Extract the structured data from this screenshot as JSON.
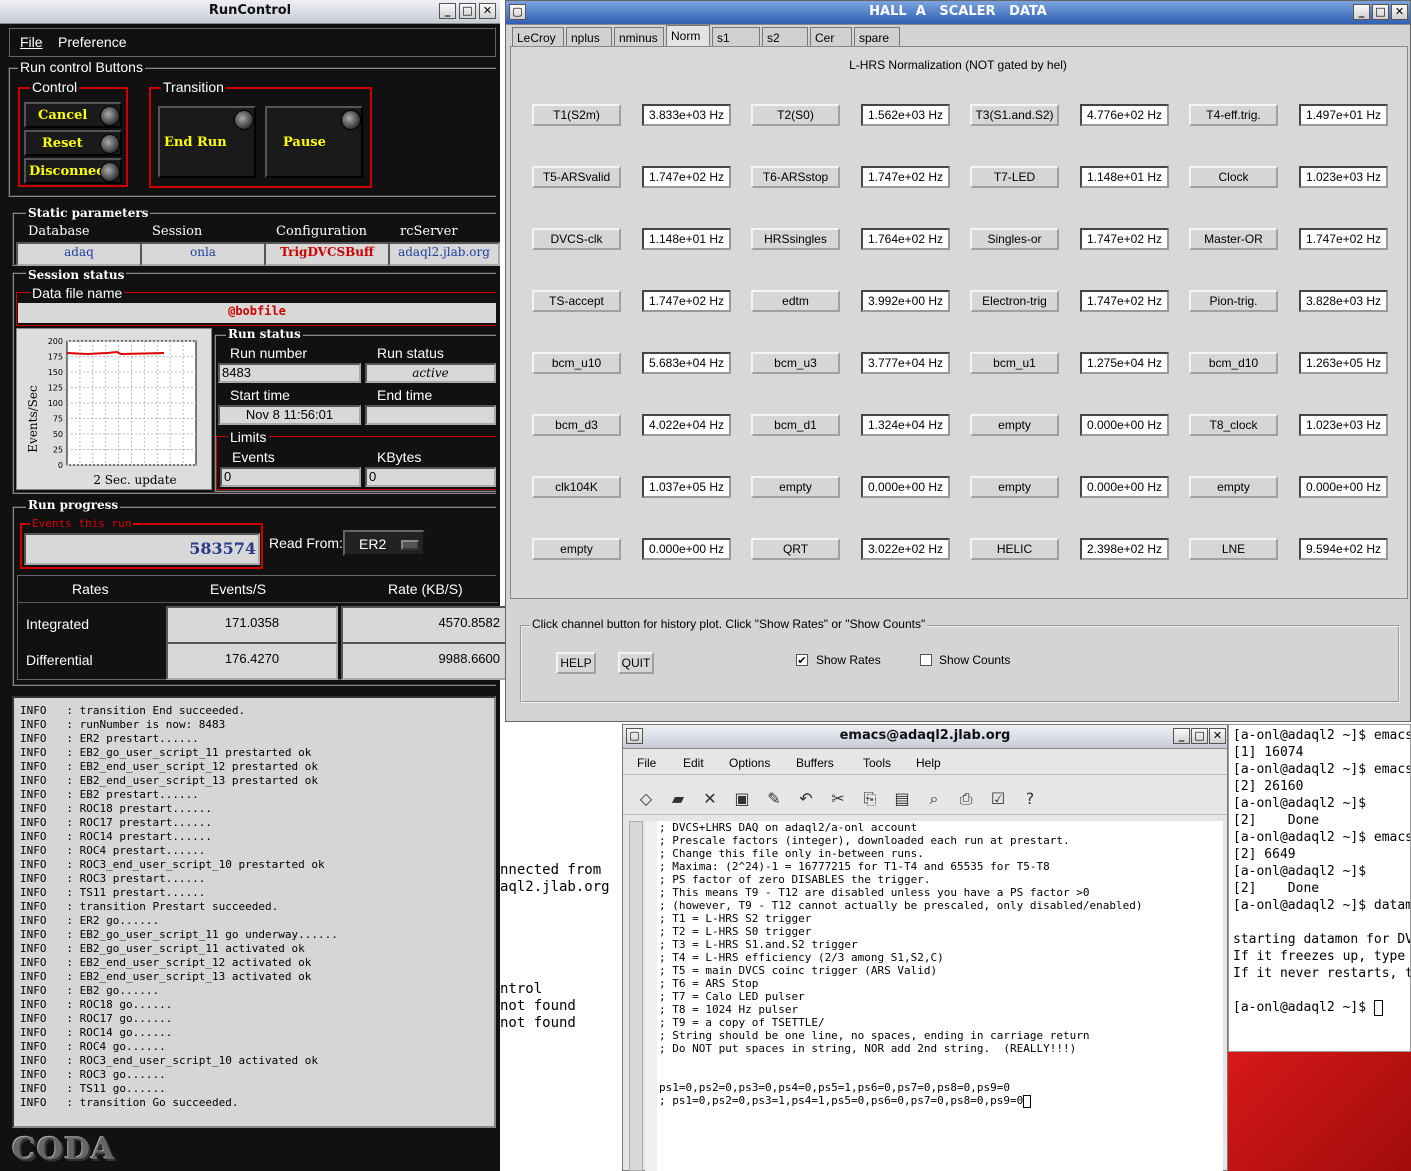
{
  "runcontrol": {
    "title": "RunControl",
    "menu": [
      "File",
      "Preference"
    ],
    "run_control_buttons_label": "Run control Buttons",
    "control_label": "Control",
    "control_buttons": [
      "Cancel",
      "Reset",
      "Disconnect"
    ],
    "transition_label": "Transition",
    "transition_buttons": [
      "End Run",
      "Pause"
    ],
    "static_params_label": "Static parameters",
    "static_params": [
      {
        "label": "Database",
        "value": "adaq"
      },
      {
        "label": "Session",
        "value": "onla"
      },
      {
        "label": "Configuration",
        "value": "TrigDVCSBuff"
      },
      {
        "label": "rcServer",
        "value": "adaql2.jlab.org"
      }
    ],
    "session_status_label": "Session status",
    "data_file_label": "Data file name",
    "data_file_value": "@bobfile",
    "chart_ylabel": "Events/Sec",
    "chart_xlabel": "2 Sec. update",
    "chart_yticks": [
      "200",
      "175",
      "150",
      "125",
      "100",
      "75",
      "50",
      "25",
      "0"
    ],
    "run_status_label": "Run status",
    "run_number_label": "Run number",
    "run_number_value": "8483",
    "run_status_field_label": "Run status",
    "run_status_value": "active",
    "start_time_label": "Start time",
    "start_time_value": "Nov 8 11:56:01",
    "end_time_label": "End time",
    "end_time_value": "",
    "limits_label": "Limits",
    "events_label": "Events",
    "events_value": "0",
    "kbytes_label": "KBytes",
    "kbytes_value": "0",
    "run_progress_label": "Run progress",
    "events_this_run_label": "Events this run",
    "events_this_run_value": "583574",
    "read_from_label": "Read From:",
    "read_from_value": "ER2",
    "rates_header": [
      "Rates",
      "Events/S",
      "Rate (KB/S)"
    ],
    "rates_rows": [
      {
        "label": "Integrated",
        "events": "171.0358",
        "kb": "4570.8582"
      },
      {
        "label": "Differential",
        "events": "176.4270",
        "kb": "9988.6600"
      }
    ],
    "log_lines": [
      "INFO   : transition End succeeded.",
      "INFO   : runNumber is now: 8483",
      "INFO   : ER2 prestart......",
      "INFO   : EB2_go_user_script_11 prestarted ok",
      "INFO   : EB2_end_user_script_12 prestarted ok",
      "INFO   : EB2_end_user_script_13 prestarted ok",
      "INFO   : EB2 prestart......",
      "INFO   : ROC18 prestart......",
      "INFO   : ROC17 prestart......",
      "INFO   : ROC14 prestart......",
      "INFO   : ROC4 prestart......",
      "INFO   : ROC3_end_user_script_10 prestarted ok",
      "INFO   : ROC3 prestart......",
      "INFO   : TS11 prestart......",
      "INFO   : transition Prestart succeeded.",
      "INFO   : ER2 go......",
      "INFO   : EB2_go_user_script_11 go underway......",
      "INFO   : EB2_go_user_script_11 activated ok",
      "INFO   : EB2_end_user_script_12 activated ok",
      "INFO   : EB2_end_user_script_13 activated ok",
      "INFO   : EB2 go......",
      "INFO   : ROC18 go......",
      "INFO   : ROC17 go......",
      "INFO   : ROC14 go......",
      "INFO   : ROC4 go......",
      "INFO   : ROC3_end_user_script_10 activated ok",
      "INFO   : ROC3 go......",
      "INFO   : TS11 go......",
      "INFO   : transition Go succeeded."
    ],
    "coda_logo": "CODA"
  },
  "scaler": {
    "title": "HALL  A   SCALER   DATA",
    "tabs": [
      "LeCroy",
      "nplus",
      "nminus",
      "Norm",
      "s1",
      "s2",
      "Cer",
      "spare"
    ],
    "selected_tab": "Norm",
    "heading": "L-HRS Normalization (NOT gated by hel)",
    "rows": [
      [
        {
          "name": "T1(S2m)",
          "rate": "3.833e+03 Hz"
        },
        {
          "name": "T2(S0)",
          "rate": "1.562e+03 Hz"
        },
        {
          "name": "T3(S1.and.S2)",
          "rate": "4.776e+02 Hz"
        },
        {
          "name": "T4-eff.trig.",
          "rate": "1.497e+01 Hz"
        }
      ],
      [
        {
          "name": "T5-ARSvalid",
          "rate": "1.747e+02 Hz"
        },
        {
          "name": "T6-ARSstop",
          "rate": "1.747e+02 Hz"
        },
        {
          "name": "T7-LED",
          "rate": "1.148e+01 Hz"
        },
        {
          "name": "Clock",
          "rate": "1.023e+03 Hz"
        }
      ],
      [
        {
          "name": "DVCS-clk",
          "rate": "1.148e+01 Hz"
        },
        {
          "name": "HRSsingles",
          "rate": "1.764e+02 Hz"
        },
        {
          "name": "Singles-or",
          "rate": "1.747e+02 Hz"
        },
        {
          "name": "Master-OR",
          "rate": "1.747e+02 Hz"
        }
      ],
      [
        {
          "name": "TS-accept",
          "rate": "1.747e+02 Hz"
        },
        {
          "name": "edtm",
          "rate": "3.992e+00 Hz"
        },
        {
          "name": "Electron-trig",
          "rate": "1.747e+02 Hz"
        },
        {
          "name": "Pion-trig.",
          "rate": "3.828e+03 Hz"
        }
      ],
      [
        {
          "name": "bcm_u10",
          "rate": "5.683e+04 Hz"
        },
        {
          "name": "bcm_u3",
          "rate": "3.777e+04 Hz"
        },
        {
          "name": "bcm_u1",
          "rate": "1.275e+04 Hz"
        },
        {
          "name": "bcm_d10",
          "rate": "1.263e+05 Hz"
        }
      ],
      [
        {
          "name": "bcm_d3",
          "rate": "4.022e+04 Hz"
        },
        {
          "name": "bcm_d1",
          "rate": "1.324e+04 Hz"
        },
        {
          "name": "empty",
          "rate": "0.000e+00 Hz"
        },
        {
          "name": "T8_clock",
          "rate": "1.023e+03 Hz"
        }
      ],
      [
        {
          "name": "clk104K",
          "rate": "1.037e+05 Hz"
        },
        {
          "name": "empty",
          "rate": "0.000e+00 Hz"
        },
        {
          "name": "empty",
          "rate": "0.000e+00 Hz"
        },
        {
          "name": "empty",
          "rate": "0.000e+00 Hz"
        }
      ],
      [
        {
          "name": "empty",
          "rate": "0.000e+00 Hz"
        },
        {
          "name": "QRT",
          "rate": "3.022e+02 Hz"
        },
        {
          "name": "HELIC",
          "rate": "2.398e+02 Hz"
        },
        {
          "name": "LNE",
          "rate": "9.594e+02 Hz"
        }
      ]
    ],
    "hint": "Click channel button for history plot.  Click \"Show Rates\" or \"Show Counts\"",
    "help_label": "HELP",
    "quit_label": "QUIT",
    "show_rates_label": "Show Rates",
    "show_counts_label": "Show Counts"
  },
  "emacs": {
    "title": "emacs@adaql2.jlab.org",
    "menu": [
      "File",
      "Edit",
      "Options",
      "Buffers",
      "Tools",
      "Help"
    ],
    "lines": [
      "; DVCS+LHRS DAQ on adaql2/a-onl account",
      "; Prescale factors (integer), downloaded each run at prestart.",
      "; Change this file only in-between runs.",
      "; Maxima: (2^24)-1 = 16777215 for T1-T4 and 65535 for T5-T8",
      "; PS factor of zero DISABLES the trigger.",
      "; This means T9 - T12 are disabled unless you have a PS factor >0",
      "; (however, T9 - T12 cannot actually be prescaled, only disabled/enabled)",
      "; T1 = L-HRS S2 trigger",
      "; T2 = L-HRS S0 trigger",
      "; T3 = L-HRS S1.and.S2 trigger",
      "; T4 = L-HRS efficiency (2/3 among S1,S2,C)",
      "; T5 = main DVCS coinc trigger (ARS Valid)",
      "; T6 = ARS Stop",
      "; T7 = Calo LED pulser",
      "; T8 = 1024 Hz pulser",
      "; T9 = a copy of TSETTLE/",
      "; String should be one line, no spaces, ending in carriage return",
      "; Do NOT put spaces in string, NOR add 2nd string.  (REALLY!!!)",
      "",
      "",
      "ps1=0,ps2=0,ps3=0,ps4=0,ps5=1,ps6=0,ps7=0,ps8=0,ps9=0",
      "; ps1=0,ps2=0,ps3=1,ps4=1,ps5=0,ps6=0,ps7=0,ps8=0,ps9=0"
    ]
  },
  "background_terminal": {
    "lines": [
      "nnected from",
      "aql2.jlab.org",
      "",
      "",
      "",
      "",
      "",
      "ntrol",
      "not found",
      "not found"
    ]
  },
  "terminal": {
    "lines": [
      "[a-onl@adaql2 ~]$ emacs",
      "[1] 16074",
      "[a-onl@adaql2 ~]$ emacs",
      "[2] 26160",
      "[a-onl@adaql2 ~]$",
      "[2]    Done",
      "[a-onl@adaql2 ~]$ emacs",
      "[2] 6649",
      "[a-onl@adaql2 ~]$",
      "[2]    Done",
      "[a-onl@adaql2 ~]$ datam",
      "",
      "starting datamon for DV",
      "If it freezes up, type",
      "If it never restarts, t",
      "",
      "[a-onl@adaql2 ~]$ "
    ]
  },
  "colors": {
    "accent_red": "#cc0000",
    "title_active": "#2e5fb3",
    "desktop_red": "#c81414"
  }
}
